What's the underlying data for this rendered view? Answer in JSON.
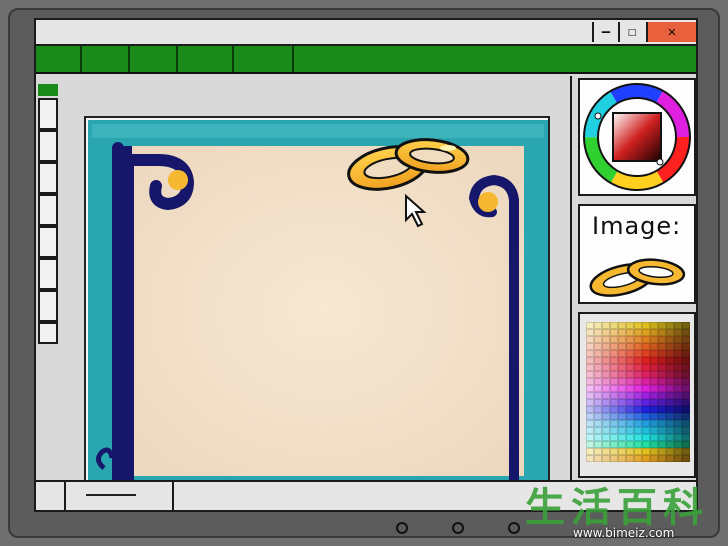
{
  "window": {
    "controls": {
      "minimize": "—",
      "maximize": "☐",
      "close": "✕"
    }
  },
  "panels": {
    "image_title": "Image:"
  },
  "colors": {
    "menubar": "#1a8a1a",
    "close_button": "#e8603c",
    "canvas_teal": "#2aa6b0",
    "paper": "#f3e2cc",
    "frame_navy": "#16166b",
    "gold": "#f6b830"
  },
  "icons": [
    "cursor-arrow-icon",
    "wedding-rings-icon",
    "color-wheel-icon"
  ],
  "watermark": {
    "characters": "生活百科",
    "url": "www.bimeiz.com"
  }
}
